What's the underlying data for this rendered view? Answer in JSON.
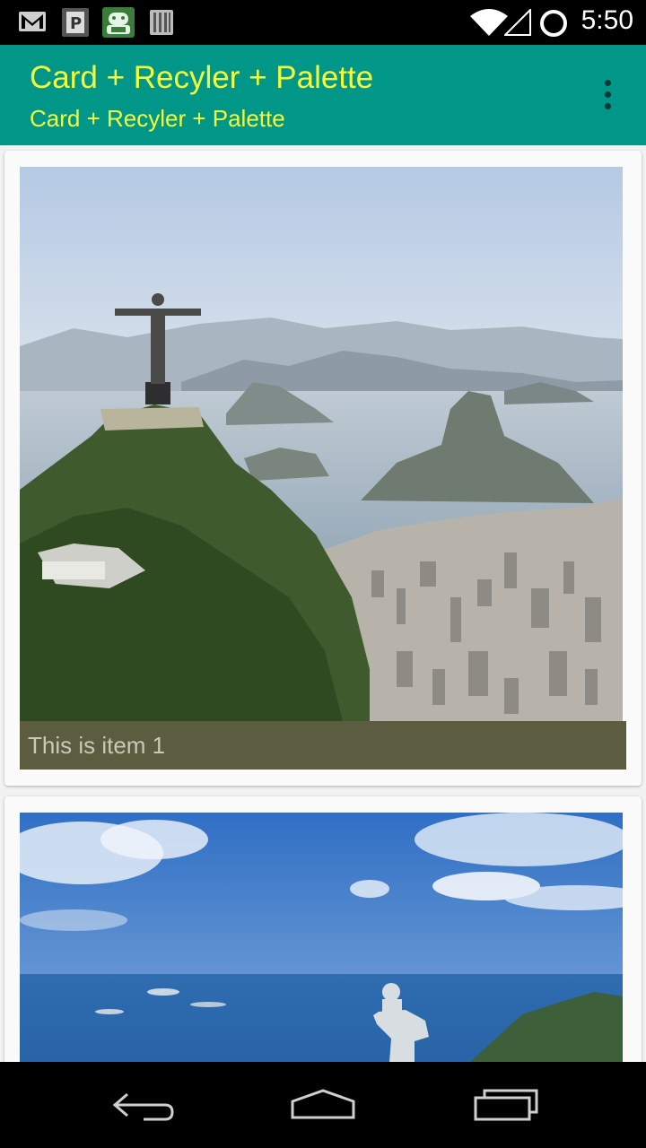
{
  "status_bar": {
    "time": "5:50",
    "icons": [
      "gmail-icon",
      "parking-icon",
      "android-icon",
      "barcode-icon",
      "wifi-icon",
      "signal-icon",
      "sync-circle-icon"
    ]
  },
  "app_bar": {
    "title": "Card + Recyler + Palette",
    "subtitle": "Card + Recyler + Palette",
    "accent_color": "#009688",
    "title_color": "#f4ff3b"
  },
  "cards": [
    {
      "caption": "This is item 1",
      "caption_bg": "#5c5c40"
    },
    {
      "caption": ""
    }
  ],
  "nav_bar": {
    "buttons": [
      "back-icon",
      "home-icon",
      "recents-icon"
    ]
  }
}
